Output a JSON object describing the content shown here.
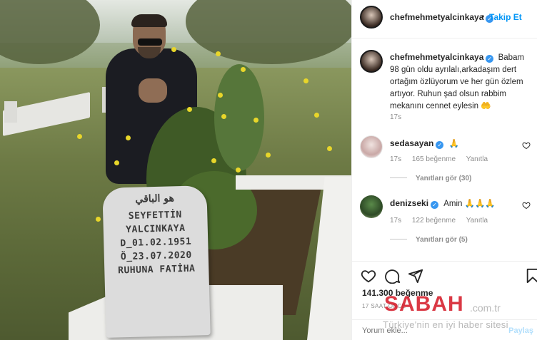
{
  "post_image": {
    "tombstone": {
      "lines": [
        "هو الباقي",
        "SEYFETTİN",
        "YALCINKAYA",
        "D_01.02.1951",
        "Ö_23.07.2020",
        "RUHUNA FATİHA"
      ]
    },
    "watermark": {
      "brand": "SABAH",
      "domain": ".com.tr",
      "tagline": "Türkiye'nin en iyi haber sitesi"
    }
  },
  "header": {
    "username": "chefmehmetyalcinkaya",
    "separator": "•",
    "follow_label": "Takip Et"
  },
  "caption": {
    "username": "chefmehmetyalcinkaya",
    "text": "Babam 98 gün oldu ayrılalı,arkadaşım dert ortağım özlüyorum ve her gün özlem artıyor. Ruhun şad olsun rabbim mekanını cennet eylesin 🤲",
    "time": "17s"
  },
  "comments": [
    {
      "username": "sedasayan",
      "text": "🙏",
      "time": "17s",
      "likes": "165 beğenme",
      "reply_label": "Yanıtla",
      "view_replies": "Yanıtları gör (30)"
    },
    {
      "username": "denizseki",
      "text": "Amin 🙏🙏🙏",
      "time": "17s",
      "likes": "122 beğenme",
      "reply_label": "Yanıtla",
      "view_replies": "Yanıtları gör (5)"
    }
  ],
  "actions": {
    "icons": [
      "heart-icon",
      "comment-icon",
      "share-icon",
      "bookmark-icon"
    ]
  },
  "likes_count": "141.300 beğenme",
  "post_time": "17 SAAT ÖNCE",
  "comment_box": {
    "placeholder": "Yorum ekle...",
    "post_label": "Paylaş"
  },
  "colors": {
    "link_blue": "#0095f6",
    "verified_blue": "#3897f0",
    "watermark_red": "#d51d2b"
  }
}
